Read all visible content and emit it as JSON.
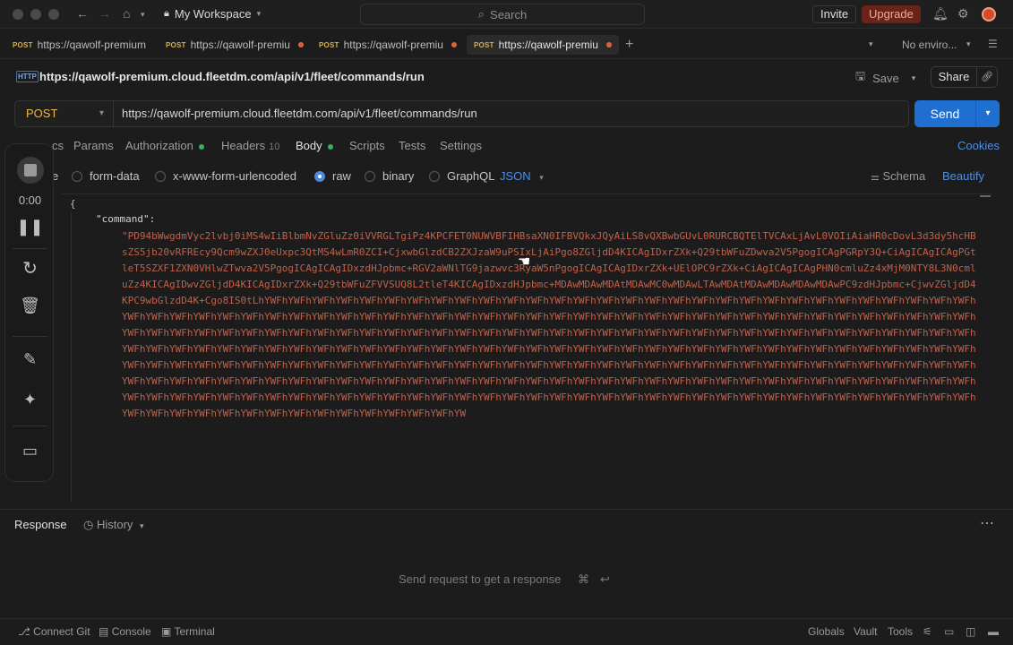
{
  "titlebar": {
    "workspace": "My Workspace",
    "search_placeholder": "Search",
    "invite": "Invite",
    "upgrade": "Upgrade"
  },
  "tabs": [
    {
      "method": "POST",
      "url": "https://qawolf-premium"
    },
    {
      "method": "POST",
      "url": "https://qawolf-premiu"
    },
    {
      "method": "POST",
      "url": "https://qawolf-premiu"
    },
    {
      "method": "POST",
      "url": "https://qawolf-premiu"
    }
  ],
  "environment": "No enviro...",
  "request": {
    "title": "https://qawolf-premium.cloud.fleetdm.com/api/v1/fleet/commands/run",
    "method": "POST",
    "url": "https://qawolf-premium.cloud.fleetdm.com/api/v1/fleet/commands/run",
    "save": "Save",
    "share": "Share",
    "send": "Send"
  },
  "request_tabs": {
    "docs": "cs",
    "params": "Params",
    "authorization": "Authorization",
    "headers": "Headers",
    "headers_count": "10",
    "body": "Body",
    "scripts": "Scripts",
    "tests": "Tests",
    "settings": "Settings",
    "cookies": "Cookies"
  },
  "body_options": {
    "none_partial": "e",
    "form_data": "form-data",
    "urlencoded": "x-www-form-urlencoded",
    "raw": "raw",
    "binary": "binary",
    "graphql": "GraphQL",
    "format": "JSON",
    "schema": "Schema",
    "beautify": "Beautify"
  },
  "editor": {
    "open_brace": "{",
    "key": "\"command\":",
    "value": "\"PD94bWwgdmVyc2lvbj0iMS4wIiBlbmNvZGluZz0iVVRGLTgiPz4KPCFET0NUWVBFIHBsaXN0IFBVQkxJQyAiLS8vQXBwbGUvL0RURCBQTElTVCAxLjAvL0VOIiAiaHR0cDovL3d3dy5hcHBsZS5jb20vRFREcy9Qcm9wZXJ0eUxpc3QtMS4wLmR0ZCI+CjxwbGlzdCB2ZXJzaW9uPSIxLjAiPgo8ZGljdD4KICAgIDxrZXk+Q29tbWFuZDwva2V5PgogICAgPGRpY3Q+CiAgICAgICAgPGtleT5SZXF1ZXN0VHlwZTwva2V5PgogICAgICAgIDxzdHJpbmc+RGV2aWNlTG9jazwvc3RyaW5nPgogICAgICAgIDxrZXk+UElOPC9rZXk+CiAgICAgICAgPHN0cmluZz4xMjM0NTY8L3N0cmluZz4KICAgIDwvZGljdD4KICAgIDxrZXk+Q29tbWFuZFVVSUQ8L2tleT4KICAgIDxzdHJpbmc+MDAwMDAwMDAtMDAwMC0wMDAwLTAwMDAtMDAwMDAwMDAwMDAwPC9zdHJpbmc+CjwvZGljdD4KPC9wbGlzdD4K+Cgo8IS0tLhYWFhYWFhYWFhYWFhYWFhYWFhYWFhYWFhYWFhYWFhYWFhYWFhYWFhYWFhYWFhYWFhYWFhYWFhYWFhYWFhYWFhYWFhYWFhYWFhYWFhYWFhYWFhYWFhYWFhYWFhYWFhYWFhYWFhYWFhYWFhYWFhYWFhYWFhYWFhYWFhYWFhYWFhYWFhYWFhYWFhYWFhYWFhYWFhYWFhYWFhYWFhYWFhYWFhYWFhYWFhYWFhYWFhYWFhYWFhYWFhYWFhYWFhYWFhYWFhYWFhYWFhYWFhYWFhYWFhYWFhYWFhYWFhYWFhYWFhYWFhYWFhYWFhYWFhYWFhYWFhYWFhYWFhYWFhYWFhYWFhYWFhYWFhYWFhYWFhYWFhYWFhYWFhYWFhYWFhYWFhYWFhYWFhYWFhYWFhYWFhYWFhYWFhYWFhYWFhYWFhYWFhYWFhYWFhYWFhYWFhYWFhYWFhYWFhYWFhYWFhYWFhYWFhYWFhYWFhYWFhYWFhYWFhYWFhYWFhYWFhYWFhYWFhYWFhYWFhYWFhYWFhYWFhYWFhYWFhYWFhYWFhYWFhYWFhYWFhYWFhYWFhYWFhYWFhYWFhYWFhYWFhYWFhYWFhYWFhYWFhYWFhYWFhYWFhYWFhYWFhYWFhYWFhYWFhYWFhYWFhYWFhYWFhYWFhYWFhYWFhYWFhYWFhYWFhYWFhYWFhYWFhYWFhYWFhYWFhYWFhYWFhYWFhYWFhYWFhYWFhYWFhYWFhYWFhYWFhYWFhYWFhYWFhYWFhYWFhYWFhYWFhYWFhYWFhYWFhYWFhYWFhYWFhYWFhYWFhYWFhYWFhYWFhYWFhYWFhYWFhYWFhYWFhYWFhYWFhYWFhYWFhYWFhYWFhYWFhYWFhYWFhYWFhYWFhYWFhYWFhYWFhYWFhYWFhYWFhYWFhYWFhYWFhYWFhYWFhYWFhYWFhYWFhYWFhYWFhYWFhYWFhYWFhYWFhYWFhYWFhYWFhYWFhYWFhYWFhYWFhYWFhYWFhYWFhYWFhYWFhYWFhYWFhYWFhYWFhYWFhYWFhYWFhYWFhYWFhYWFhYW"
  },
  "recorder": {
    "timer": "0:00"
  },
  "response": {
    "label": "Response",
    "history": "History",
    "empty_message": "Send request to get a response",
    "shortcut_cmd": "⌘",
    "shortcut_enter": "↩"
  },
  "statusbar": {
    "connect_git": "Connect Git",
    "console": "Console",
    "terminal": "Terminal",
    "globals": "Globals",
    "vault": "Vault",
    "tools": "Tools"
  }
}
